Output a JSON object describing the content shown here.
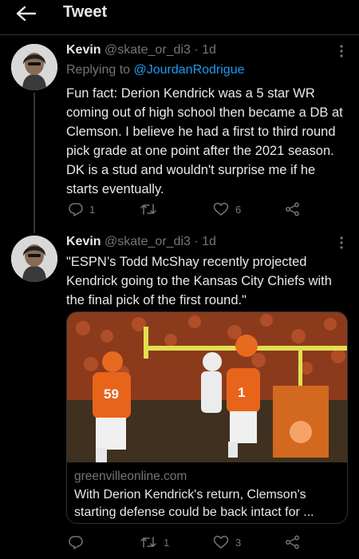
{
  "header": {
    "title": "Tweet"
  },
  "replying_prefix": "Replying to",
  "tweets": [
    {
      "name": "Kevin",
      "handle": "@skate_or_di3 · 1d",
      "replying_to": "@JourdanRodrigue",
      "text": "Fun fact: Derion Kendrick was a 5 star WR coming out of high school then became a DB at Clemson. I believe he had a first to third round pick grade at one point after the 2021 season. DK is a stud and wouldn't surprise me if he starts eventually.",
      "replies": "1",
      "retweets": "",
      "likes": "6"
    },
    {
      "name": "Kevin",
      "handle": "@skate_or_di3 · 1d",
      "text": "\"ESPN’s Todd McShay recently projected Kendrick going to the Kansas City Chiefs with the final pick of the first round.\"",
      "card": {
        "domain": "greenvilleonline.com",
        "title": "With Derion Kendrick's return, Clemson's starting defense could be back intact for ..."
      },
      "replies": "",
      "retweets": "1",
      "likes": "3"
    }
  ],
  "colors": {
    "background": "#000000",
    "text": "#e7e9ea",
    "secondary": "#71767b",
    "accent": "#1d9bf0",
    "jersey_orange": "#e8641a"
  },
  "icons": [
    "back-arrow-icon",
    "more-icon",
    "reply-icon",
    "retweet-icon",
    "like-icon",
    "share-icon"
  ]
}
